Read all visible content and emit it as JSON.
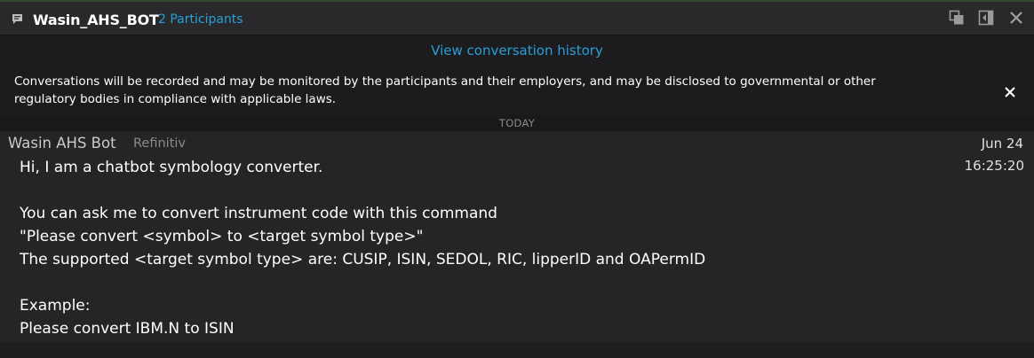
{
  "header": {
    "title": "Wasin_AHS_BOT",
    "participants_link": "2 Participants",
    "icons": [
      "chat-icon",
      "popout-icon",
      "collapse-panel-icon",
      "close-icon"
    ]
  },
  "history_link": "View conversation history",
  "notice": {
    "text": "Conversations will be recorded and may be monitored by the participants and their employers, and may be disclosed to governmental or other regulatory bodies in compliance with applicable laws."
  },
  "day_separator": "TODAY",
  "message": {
    "sender": "Wasin AHS Bot",
    "organization": "Refinitiv",
    "date": "Jun 24",
    "time": "16:25:20",
    "lines": [
      "Hi, I am a chatbot symbology converter.",
      "",
      "You can ask me to convert instrument code with this command",
      "\"Please convert <symbol> to <target symbol type>\"",
      "The supported <target symbol type> are: CUSIP, ISIN, SEDOL, RIC, lipperID and OAPermID",
      "",
      "Example:",
      "Please convert IBM.N to ISIN"
    ]
  },
  "colors": {
    "accent_link": "#2a9fd8",
    "background": "#1f1f21",
    "message_background": "#252527"
  }
}
